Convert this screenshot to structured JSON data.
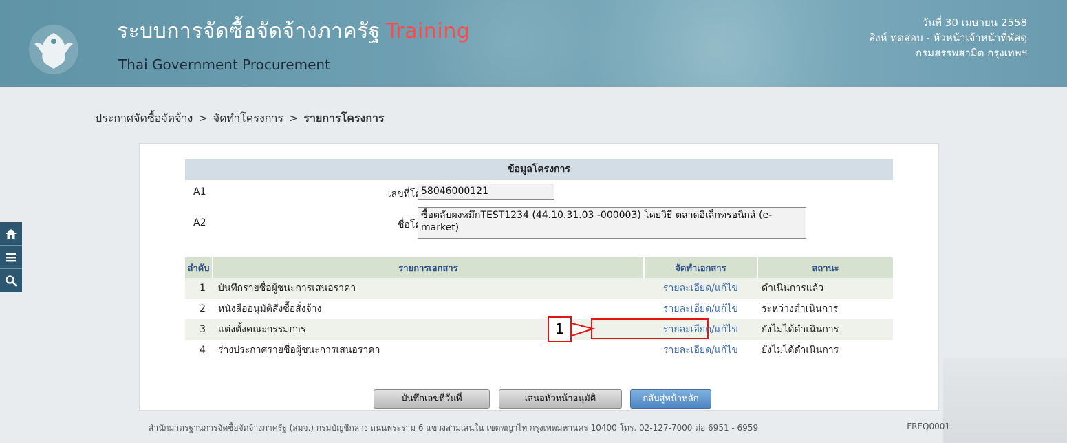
{
  "header": {
    "title": "ระบบการจัดซื้อจัดจ้างภาครัฐ",
    "title_suffix": "Training",
    "subtitle": "Thai Government Procurement",
    "date": "วันที่ 30 เมษายน 2558",
    "user": "สิงห์ ทดสอบ - หัวหน้าเจ้าหน้าที่พัสดุ",
    "department": "กรมสรรพสามิต กรุงเทพฯ",
    "logo_icon": "garuda-logo-icon"
  },
  "sidebar": {
    "items": [
      {
        "icon": "home-icon"
      },
      {
        "icon": "menu-icon"
      },
      {
        "icon": "search-icon"
      }
    ]
  },
  "breadcrumb": {
    "items": [
      "ประกาศจัดซื้อจัดจ้าง",
      "จัดทำโครงการ",
      "รายการโครงการ"
    ],
    "separator": ">"
  },
  "project_info": {
    "header": "ข้อมูลโครงการ",
    "rows": [
      {
        "code": "A1",
        "label": "เลขที่โครงการ",
        "value": "58046000121"
      },
      {
        "code": "A2",
        "label": "ชื่อโครงการ",
        "value": "ซื้อตลับผงหมึกTEST1234 (44.10.31.03 -000003) โดยวิธี ตลาดอิเล็กทรอนิกส์ (e-market)"
      }
    ]
  },
  "documents": {
    "columns": [
      "ลำดับ",
      "รายการเอกสาร",
      "จัดทำเอกสาร",
      "สถานะ"
    ],
    "rows": [
      {
        "no": "1",
        "name": "บันทึกรายชื่อผู้ชนะการเสนอราคา",
        "action": "รายละเอียด/แก้ไข",
        "status": "ดำเนินการแล้ว"
      },
      {
        "no": "2",
        "name": "หนังสืออนุมัติสั่งซื้อสั่งจ้าง",
        "action": "รายละเอียด/แก้ไข",
        "status": "ระหว่างดำเนินการ"
      },
      {
        "no": "3",
        "name": "แต่งตั้งคณะกรรมการ",
        "action": "รายละเอียด/แก้ไข",
        "status": "ยังไม่ได้ดำเนินการ"
      },
      {
        "no": "4",
        "name": "ร่างประกาศรายชื่อผู้ชนะการเสนอราคา",
        "action": "รายละเอียด/แก้ไข",
        "status": "ยังไม่ได้ดำเนินการ"
      }
    ]
  },
  "annotation": {
    "label": "1",
    "color": "#e11515"
  },
  "buttons": {
    "save": "บันทึกเลขที่วันที่",
    "propose": "เสนอหัวหน้าอนุมัติ",
    "back": "กลับสู่หน้าหลัก"
  },
  "footer": {
    "text": "สำนักมาตรฐานการจัดซื้อจัดจ้างภาครัฐ (สมจ.) กรมบัญชีกลาง ถนนพระราม 6 แขวงสามเสนใน เขตพญาไท กรุงเทพมหานคร 10400 โทร. 02-127-7000 ต่อ 6951 - 6959",
    "code": "FREQ0001"
  }
}
